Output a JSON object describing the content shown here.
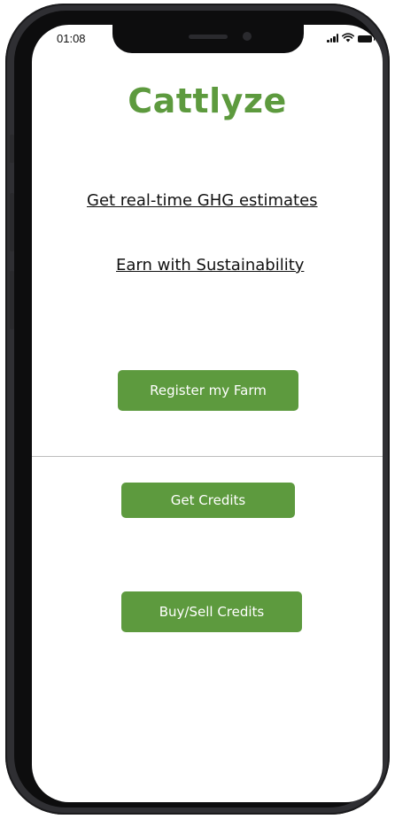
{
  "status_bar": {
    "time": "01:08",
    "icons": [
      "cellular-signal-icon",
      "wifi-icon",
      "battery-icon"
    ]
  },
  "app": {
    "title": "Cattlyze"
  },
  "links": {
    "ghg_estimates": "Get real-time GHG estimates ",
    "sustainability": "Earn with Sustainability "
  },
  "buttons": {
    "register_farm": "Register my Farm",
    "get_credits": "Get Credits",
    "buy_sell_credits": "Buy/Sell Credits"
  },
  "colors": {
    "accent": "#5d9a3e",
    "button_text": "#ffffff",
    "frame": "#2f2f33"
  }
}
